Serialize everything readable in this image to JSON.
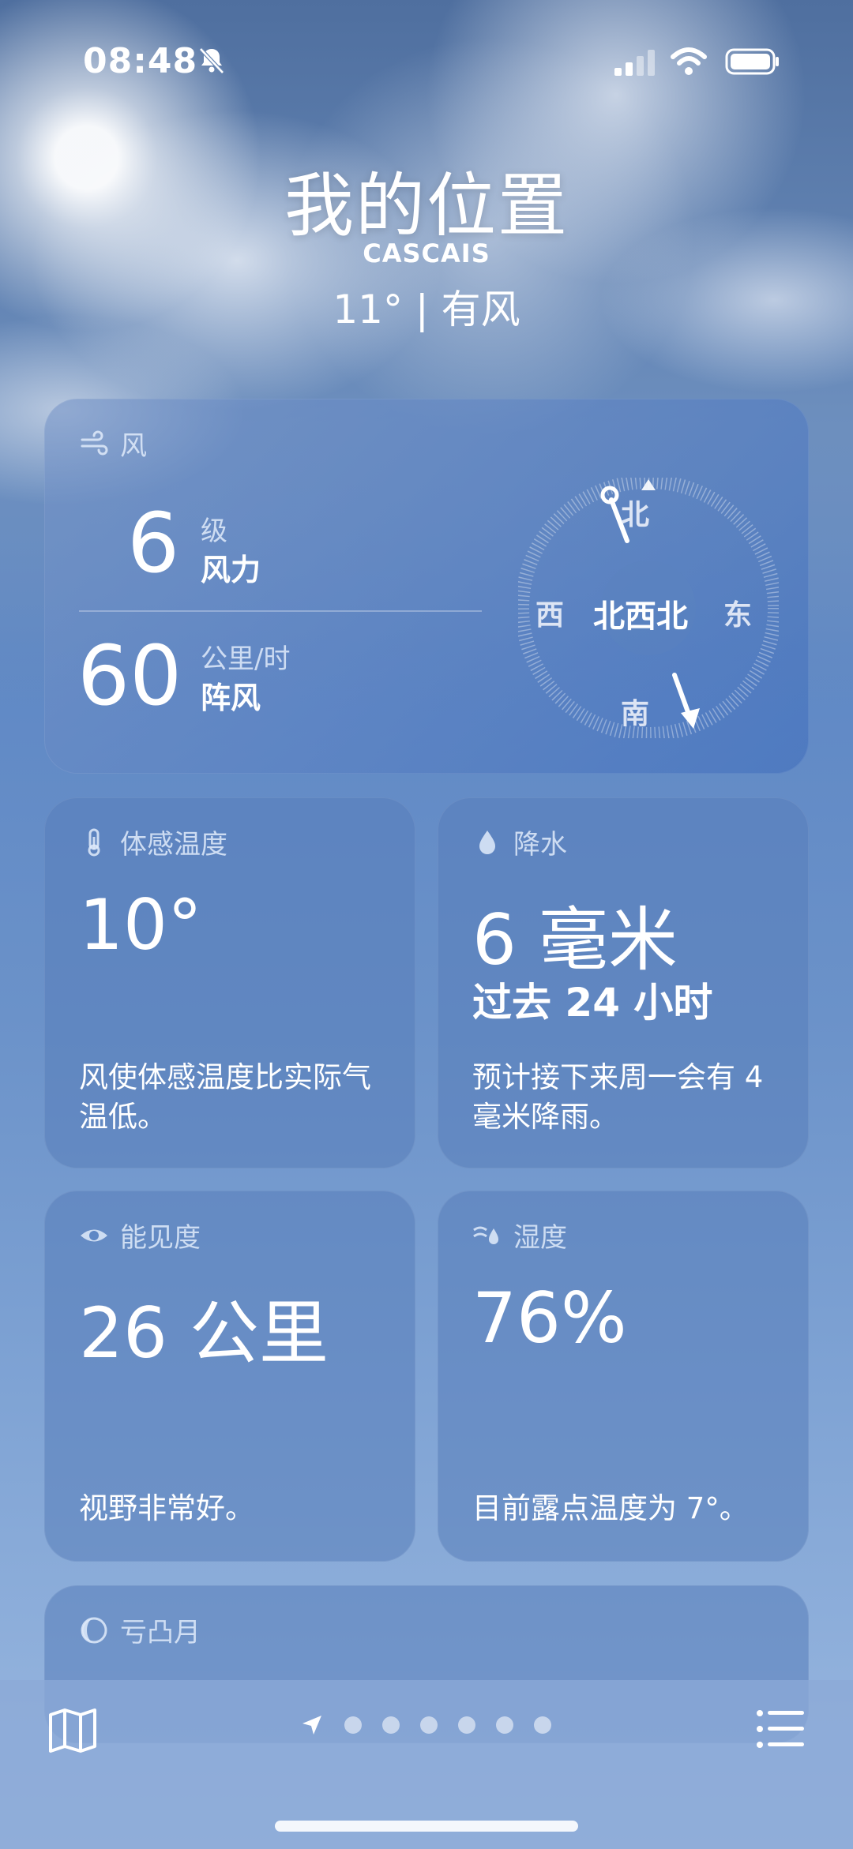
{
  "status": {
    "time": "08:48"
  },
  "location": {
    "title": "我的位置",
    "subtitle": "CASCAIS",
    "condition": "11° | 有风"
  },
  "wind": {
    "header": "风",
    "level_value": "6",
    "level_unit": "级",
    "level_label": "风力",
    "gust_value": "60",
    "gust_unit": "公里/时",
    "gust_label": "阵风",
    "direction": "北西北",
    "compass": {
      "n": "北",
      "s": "南",
      "e": "东",
      "w": "西"
    }
  },
  "feels_like": {
    "header": "体感温度",
    "value": "10°",
    "desc": "风使体感温度比实际气温低。"
  },
  "precip": {
    "header": "降水",
    "value": "6 毫米",
    "period": "过去 24 小时",
    "desc": "预计接下来周一会有 4 毫米降雨。"
  },
  "visibility": {
    "header": "能见度",
    "value": "26 公里",
    "desc": "视野非常好。"
  },
  "humidity": {
    "header": "湿度",
    "value": "76%",
    "desc": "目前露点温度为 7°。"
  },
  "moon": {
    "header": "亏凸月"
  },
  "page_indicator": {
    "count": 6,
    "current": 0
  }
}
